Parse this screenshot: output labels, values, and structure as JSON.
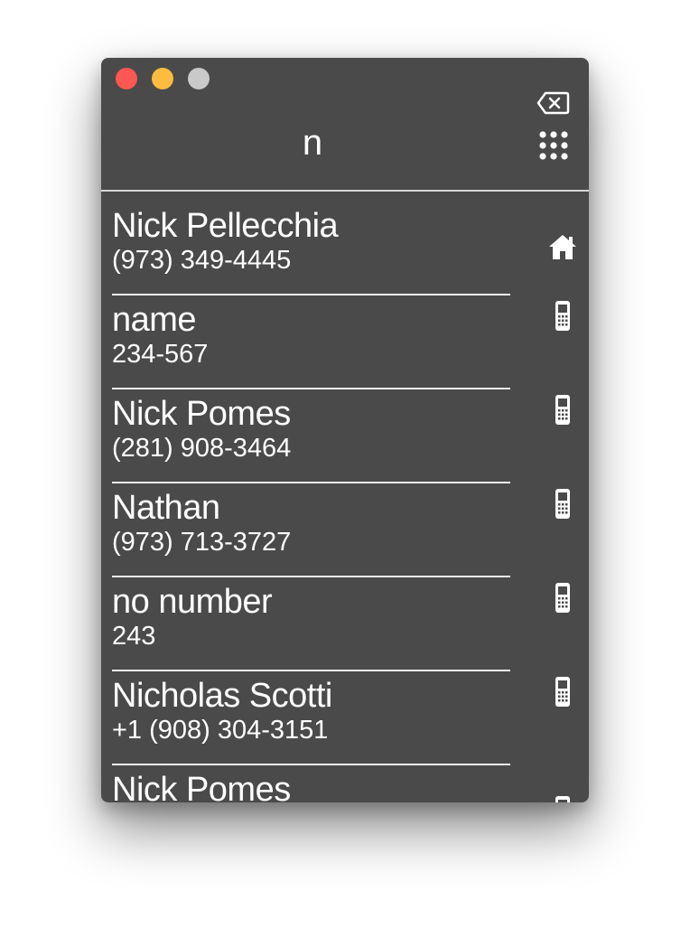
{
  "window": {
    "controls": [
      "close",
      "minimize",
      "zoom"
    ]
  },
  "search": {
    "query": "n"
  },
  "toolbar": {
    "backspace_icon": "backspace-icon",
    "keypad_icon": "keypad-icon"
  },
  "contacts": [
    {
      "name": "Nick Pellecchia",
      "number": "(973) 349-4445",
      "type_icon": "home-icon"
    },
    {
      "name": "name",
      "number": "234-567",
      "type_icon": "mobile-phone-icon"
    },
    {
      "name": "Nick Pomes",
      "number": "(281) 908-3464",
      "type_icon": "mobile-phone-icon"
    },
    {
      "name": "Nathan",
      "number": "(973) 713-3727",
      "type_icon": "mobile-phone-icon"
    },
    {
      "name": "no number",
      "number": "243",
      "type_icon": "mobile-phone-icon"
    },
    {
      "name": "Nicholas Scotti",
      "number": "+1 (908) 304-3151",
      "type_icon": "mobile-phone-icon"
    },
    {
      "name": "Nick Pomes",
      "number": "",
      "type_icon": "mobile-phone-icon"
    }
  ],
  "colors": {
    "window_bg": "#4a4a4a",
    "text": "#ffffff",
    "close": "#fc5753",
    "minimize": "#fdbc40",
    "zoom": "#c9c9c9"
  }
}
